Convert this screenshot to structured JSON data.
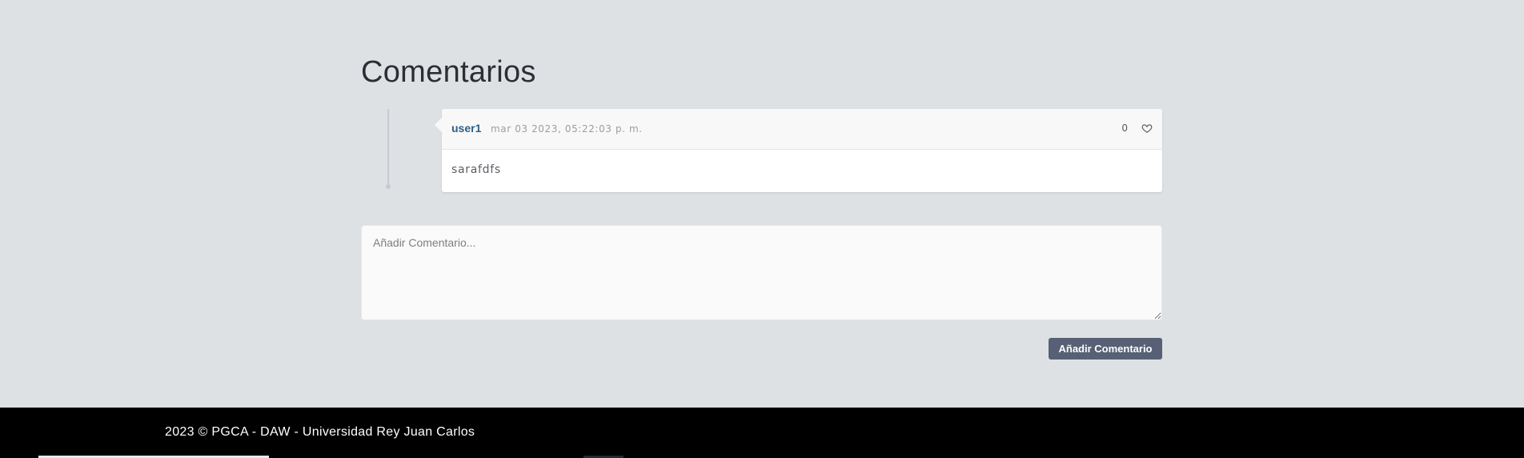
{
  "comments_section": {
    "title": "Comentarios"
  },
  "comments": [
    {
      "author": "user1",
      "date": "mar 03 2023, 05:22:03 p. m.",
      "likes": "0",
      "text": "sarafdfs"
    }
  ],
  "add_comment": {
    "placeholder": "Añadir Comentario...",
    "button_label": "Añadir Comentario"
  },
  "footer": {
    "text": "2023 © PGCA - DAW - Universidad Rey Juan Carlos"
  },
  "colors": {
    "background": "#dee1e4",
    "author_link": "#2f5e85",
    "button": "#576075",
    "footer": "#000000"
  },
  "icons": {
    "like": "heart-icon"
  }
}
